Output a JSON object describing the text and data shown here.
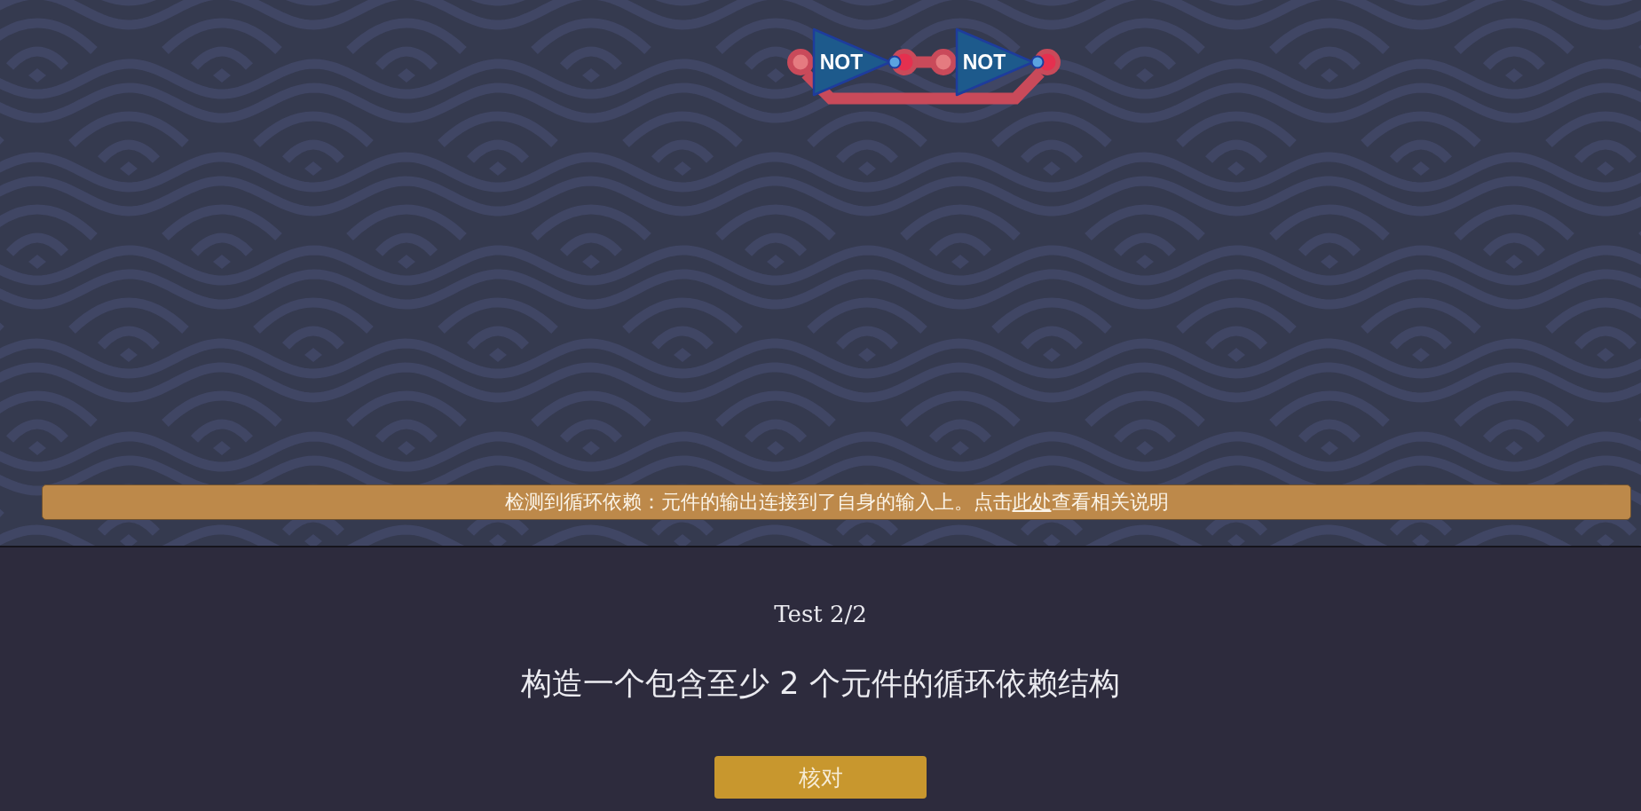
{
  "circuit": {
    "gates": [
      {
        "kind": "not",
        "label": "NOT"
      },
      {
        "kind": "not",
        "label": "NOT"
      }
    ],
    "wires": [
      {
        "kind": "direct"
      },
      {
        "kind": "feedback"
      }
    ]
  },
  "warning": {
    "text_start": "检测到循环依赖：元件的输出连接到了自身的输入上。点击",
    "link": "此处",
    "text_end": "查看相关说明"
  },
  "test_counter": "Test 2/2",
  "task": "构造一个包含至少 2 个元件的循环依赖结构",
  "check_button": {
    "label": "核对"
  }
}
